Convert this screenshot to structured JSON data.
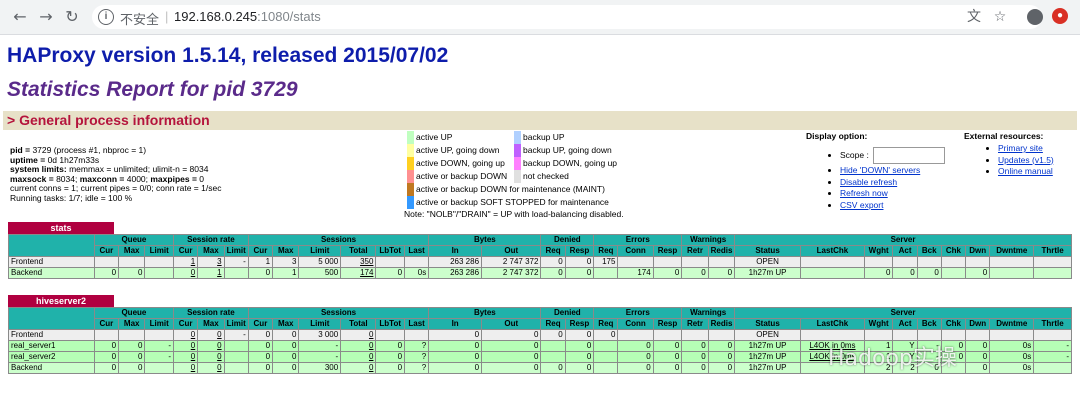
{
  "browser": {
    "security_label": "不安全",
    "host": "192.168.0.245",
    "path": ":1080/stats"
  },
  "page": {
    "title": "HAProxy version 1.5.14, released 2015/07/02",
    "subtitle": "Statistics Report for pid 3729",
    "section_title": "> General process information"
  },
  "process": {
    "pid_label": "pid = ",
    "pid_value": "3729 (process #1, nbproc = 1)",
    "uptime_label": "uptime = ",
    "uptime_value": "0d 1h27m33s",
    "limits_label": "system limits:",
    "limits_value": " memmax = unlimited; ulimit-n = 8034",
    "maxsock_label": "maxsock = ",
    "maxsock_value": "8034; ",
    "maxconn_label": "maxconn = ",
    "maxconn_value": "4000; ",
    "maxpipes_label": "maxpipes = ",
    "maxpipes_value": "0",
    "conns_line": "current conns = 1; current pipes = 0/0; conn rate = 1/sec",
    "tasks_line": "Running tasks: 1/7; idle = 100 %"
  },
  "legend_left": [
    {
      "label": "active UP",
      "color": "#c0ffc0"
    },
    {
      "label": "active UP, going down",
      "color": "#ffffa0"
    },
    {
      "label": "active DOWN, going up",
      "color": "#ffd020"
    },
    {
      "label": "active or backup DOWN",
      "color": "#ff9090"
    },
    {
      "label": "active or backup DOWN for maintenance (MAINT)",
      "color": "#c07820"
    },
    {
      "label": "active or backup SOFT STOPPED for maintenance",
      "color": "#3399ff"
    }
  ],
  "legend_right": [
    {
      "label": "backup UP",
      "color": "#b0d0ff"
    },
    {
      "label": "backup UP, going down",
      "color": "#c060ff"
    },
    {
      "label": "backup DOWN, going up",
      "color": "#ff80ff"
    },
    {
      "label": "not checked",
      "color": "#e0e0e0"
    }
  ],
  "legend_note": "Note: \"NOLB\"/\"DRAIN\" = UP with load-balancing disabled.",
  "display_options": {
    "title": "Display option:",
    "scope_label": "Scope :",
    "links": [
      "Hide 'DOWN' servers",
      "Disable refresh",
      "Refresh now",
      "CSV export"
    ]
  },
  "external_resources": {
    "title": "External resources:",
    "links": [
      "Primary site",
      "Updates (v1.5)",
      "Online manual"
    ]
  },
  "stats": {
    "name": "stats",
    "groups": [
      "Queue",
      "Session rate",
      "Sessions",
      "Bytes",
      "Denied",
      "Errors",
      "Warnings",
      "Server"
    ],
    "cols": [
      "Cur",
      "Max",
      "Limit",
      "Cur",
      "Max",
      "Limit",
      "Cur",
      "Max",
      "Limit",
      "Total",
      "LbTot",
      "Last",
      "In",
      "Out",
      "Req",
      "Resp",
      "Req",
      "Conn",
      "Resp",
      "Retr",
      "Redis",
      "Status",
      "LastChk",
      "Wght",
      "Act",
      "Bck",
      "Chk",
      "Dwn",
      "Dwntme",
      "Thrtle"
    ],
    "rows": [
      {
        "name": "Frontend",
        "v": [
          "",
          "",
          "",
          "1",
          "3",
          "-",
          "1",
          "3",
          "5 000",
          "350",
          "",
          "",
          "263 286",
          "2 747 372",
          "0",
          "0",
          "175",
          "",
          "",
          "",
          "",
          "OPEN",
          "",
          "",
          "",
          "",
          "",
          "",
          "",
          ""
        ]
      },
      {
        "name": "Backend",
        "v": [
          "0",
          "0",
          "",
          "0",
          "1",
          "",
          "0",
          "1",
          "500",
          "174",
          "0",
          "0s",
          "263 286",
          "2 747 372",
          "0",
          "0",
          "",
          "174",
          "0",
          "0",
          "0",
          "1h27m UP",
          "",
          "0",
          "0",
          "0",
          "",
          "0",
          "",
          ""
        ]
      }
    ]
  },
  "hiveserver2": {
    "name": "hiveserver2",
    "groups": [
      "Queue",
      "Session rate",
      "Sessions",
      "Bytes",
      "Denied",
      "Errors",
      "Warnings",
      "Server"
    ],
    "cols": [
      "Cur",
      "Max",
      "Limit",
      "Cur",
      "Max",
      "Limit",
      "Cur",
      "Max",
      "Limit",
      "Total",
      "LbTot",
      "Last",
      "In",
      "Out",
      "Req",
      "Resp",
      "Req",
      "Conn",
      "Resp",
      "Retr",
      "Redis",
      "Status",
      "LastChk",
      "Wght",
      "Act",
      "Bck",
      "Chk",
      "Dwn",
      "Dwntme",
      "Thrtle"
    ],
    "rows": [
      {
        "name": "Frontend",
        "v": [
          "",
          "",
          "",
          "0",
          "0",
          "-",
          "0",
          "0",
          "3 000",
          "0",
          "",
          "",
          "0",
          "0",
          "0",
          "0",
          "0",
          "",
          "",
          "",
          "",
          "OPEN",
          "",
          "",
          "",
          "",
          "",
          "",
          "",
          ""
        ]
      },
      {
        "name": "real_server1",
        "v": [
          "0",
          "0",
          "-",
          "0",
          "0",
          "",
          "0",
          "0",
          "-",
          "0",
          "0",
          "?",
          "0",
          "0",
          "",
          "0",
          "",
          "0",
          "0",
          "0",
          "0",
          "1h27m UP",
          "L4OK in 0ms",
          "1",
          "Y",
          "-",
          "0",
          "0",
          "0s",
          "-"
        ]
      },
      {
        "name": "real_server2",
        "v": [
          "0",
          "0",
          "-",
          "0",
          "0",
          "",
          "0",
          "0",
          "-",
          "0",
          "0",
          "?",
          "0",
          "0",
          "",
          "0",
          "",
          "0",
          "0",
          "0",
          "0",
          "1h27m UP",
          "L4OK in 0ms",
          "1",
          "Y",
          "-",
          "0",
          "0",
          "0s",
          "-"
        ]
      },
      {
        "name": "Backend",
        "v": [
          "0",
          "0",
          "",
          "0",
          "0",
          "",
          "0",
          "0",
          "300",
          "0",
          "0",
          "?",
          "0",
          "0",
          "0",
          "0",
          "",
          "0",
          "0",
          "0",
          "0",
          "1h27m UP",
          "",
          "2",
          "2",
          "0",
          "",
          "0",
          "0s",
          ""
        ]
      }
    ]
  },
  "watermark": "Hadoop实操"
}
